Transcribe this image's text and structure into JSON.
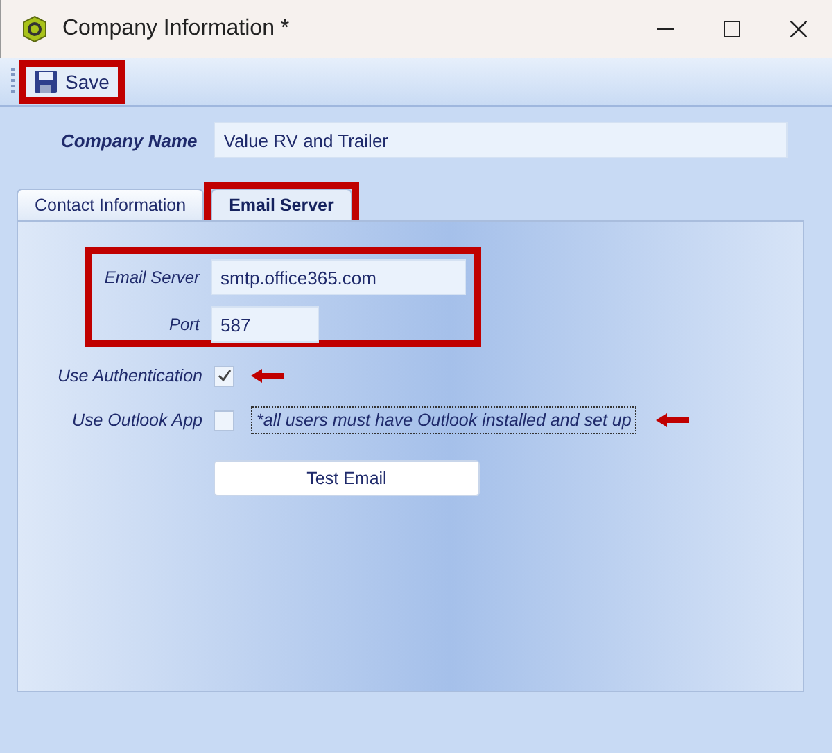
{
  "window": {
    "title": "Company Information *"
  },
  "toolbar": {
    "buttons": [
      {
        "label": "Save",
        "highlighted": true
      }
    ]
  },
  "company_name": {
    "label": "Company Name",
    "value": "Value RV and Trailer"
  },
  "tabs": [
    {
      "label": "Contact Information",
      "selected": false,
      "highlighted": false
    },
    {
      "label": "Email Server",
      "selected": true,
      "highlighted": true
    }
  ],
  "email_server": {
    "highlighted": true,
    "fields": [
      {
        "label": "Email Server",
        "value": "smtp.office365.com",
        "kind": "wide"
      },
      {
        "label": "Port",
        "value": "587",
        "kind": "narrow"
      }
    ],
    "options": [
      {
        "label": "Use Authentication",
        "checked": true,
        "pointed": true
      },
      {
        "label": "Use Outlook App",
        "checked": false,
        "note": "*all users must have Outlook installed and set up",
        "pointed": true
      }
    ],
    "button": "Test Email"
  }
}
